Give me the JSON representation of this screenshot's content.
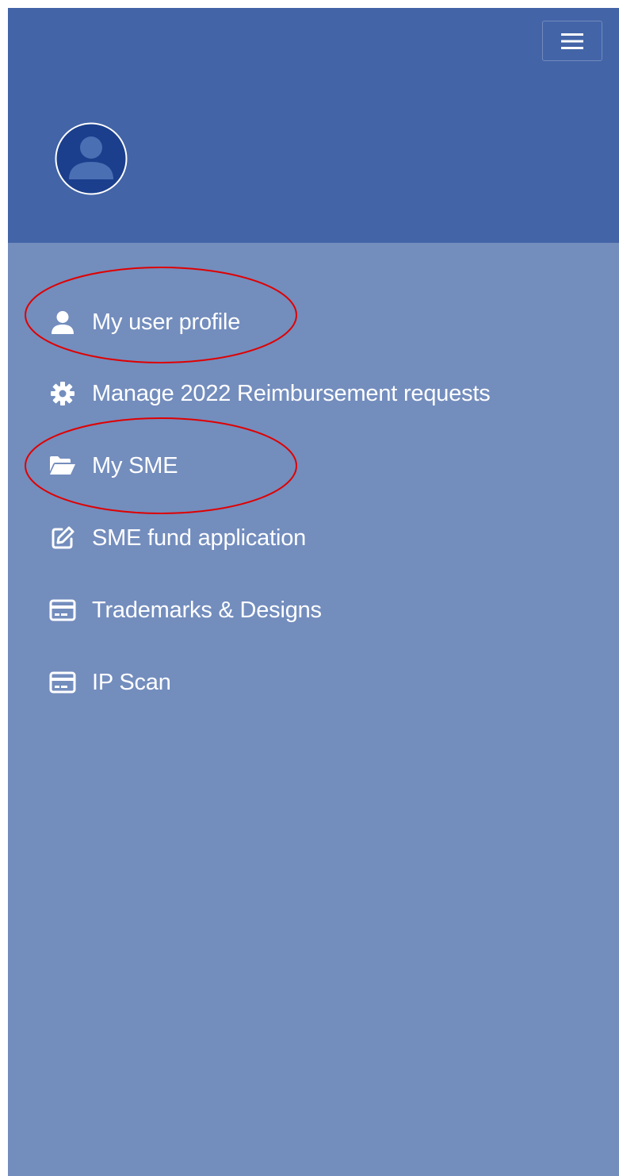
{
  "colors": {
    "header_bg": "#4364a7",
    "sidebar_bg": "#738dbd",
    "text": "#ffffff",
    "avatar_fill": "#1b3f8c",
    "annotation": "#e00000"
  },
  "header": {
    "menu_icon": "hamburger-menu-icon",
    "avatar_icon": "user-avatar-icon"
  },
  "menu": {
    "items": [
      {
        "label": "My user profile",
        "icon": "user-icon",
        "circled": true
      },
      {
        "label": "Manage 2022 Reimbursement requests",
        "icon": "gear-icon",
        "circled": false
      },
      {
        "label": "My SME",
        "icon": "folder-open-icon",
        "circled": true
      },
      {
        "label": "SME fund application",
        "icon": "edit-icon",
        "circled": false
      },
      {
        "label": "Trademarks & Designs",
        "icon": "credit-card-icon",
        "circled": false
      },
      {
        "label": "IP Scan",
        "icon": "credit-card-icon",
        "circled": false
      }
    ]
  }
}
